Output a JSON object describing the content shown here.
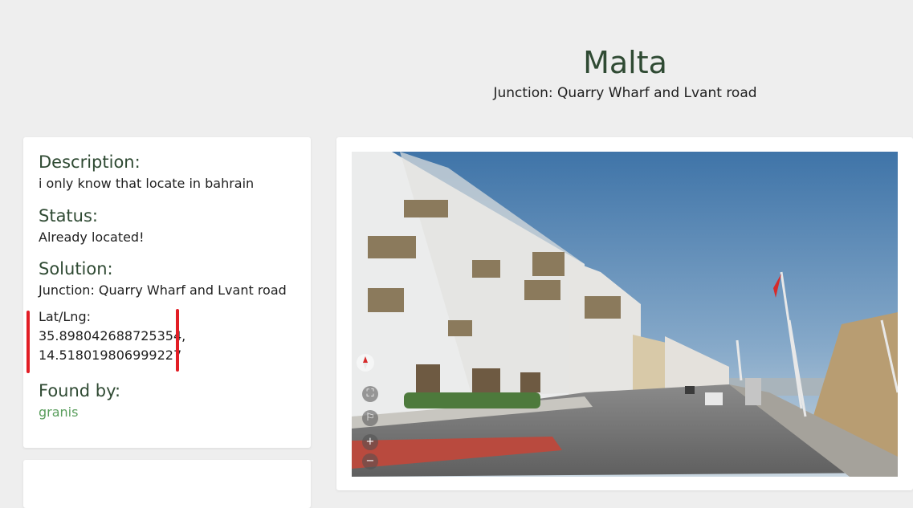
{
  "header": {
    "title": "Malta",
    "subtitle": "Junction: Quarry Wharf and Lvant road"
  },
  "info": {
    "description_heading": "Description:",
    "description": "i only know that locate in bahrain",
    "status_heading": "Status:",
    "status": "Already located!",
    "solution_heading": "Solution:",
    "solution": "Junction: Quarry Wharf and Lvant road",
    "latlng_label": "Lat/Lng:",
    "lat": "35.898042688725354,",
    "lng": "14.518019806999227",
    "found_by_heading": "Found by:",
    "found_by": "granis"
  },
  "streetview": {
    "zoom_in": "+",
    "zoom_out": "−",
    "fullscreen": "⛶",
    "report": "⚐"
  },
  "colors": {
    "heading": "#2f4a33",
    "link": "#5a9e5d",
    "highlight_marks": "#e21d25",
    "background": "#eeeeee"
  }
}
